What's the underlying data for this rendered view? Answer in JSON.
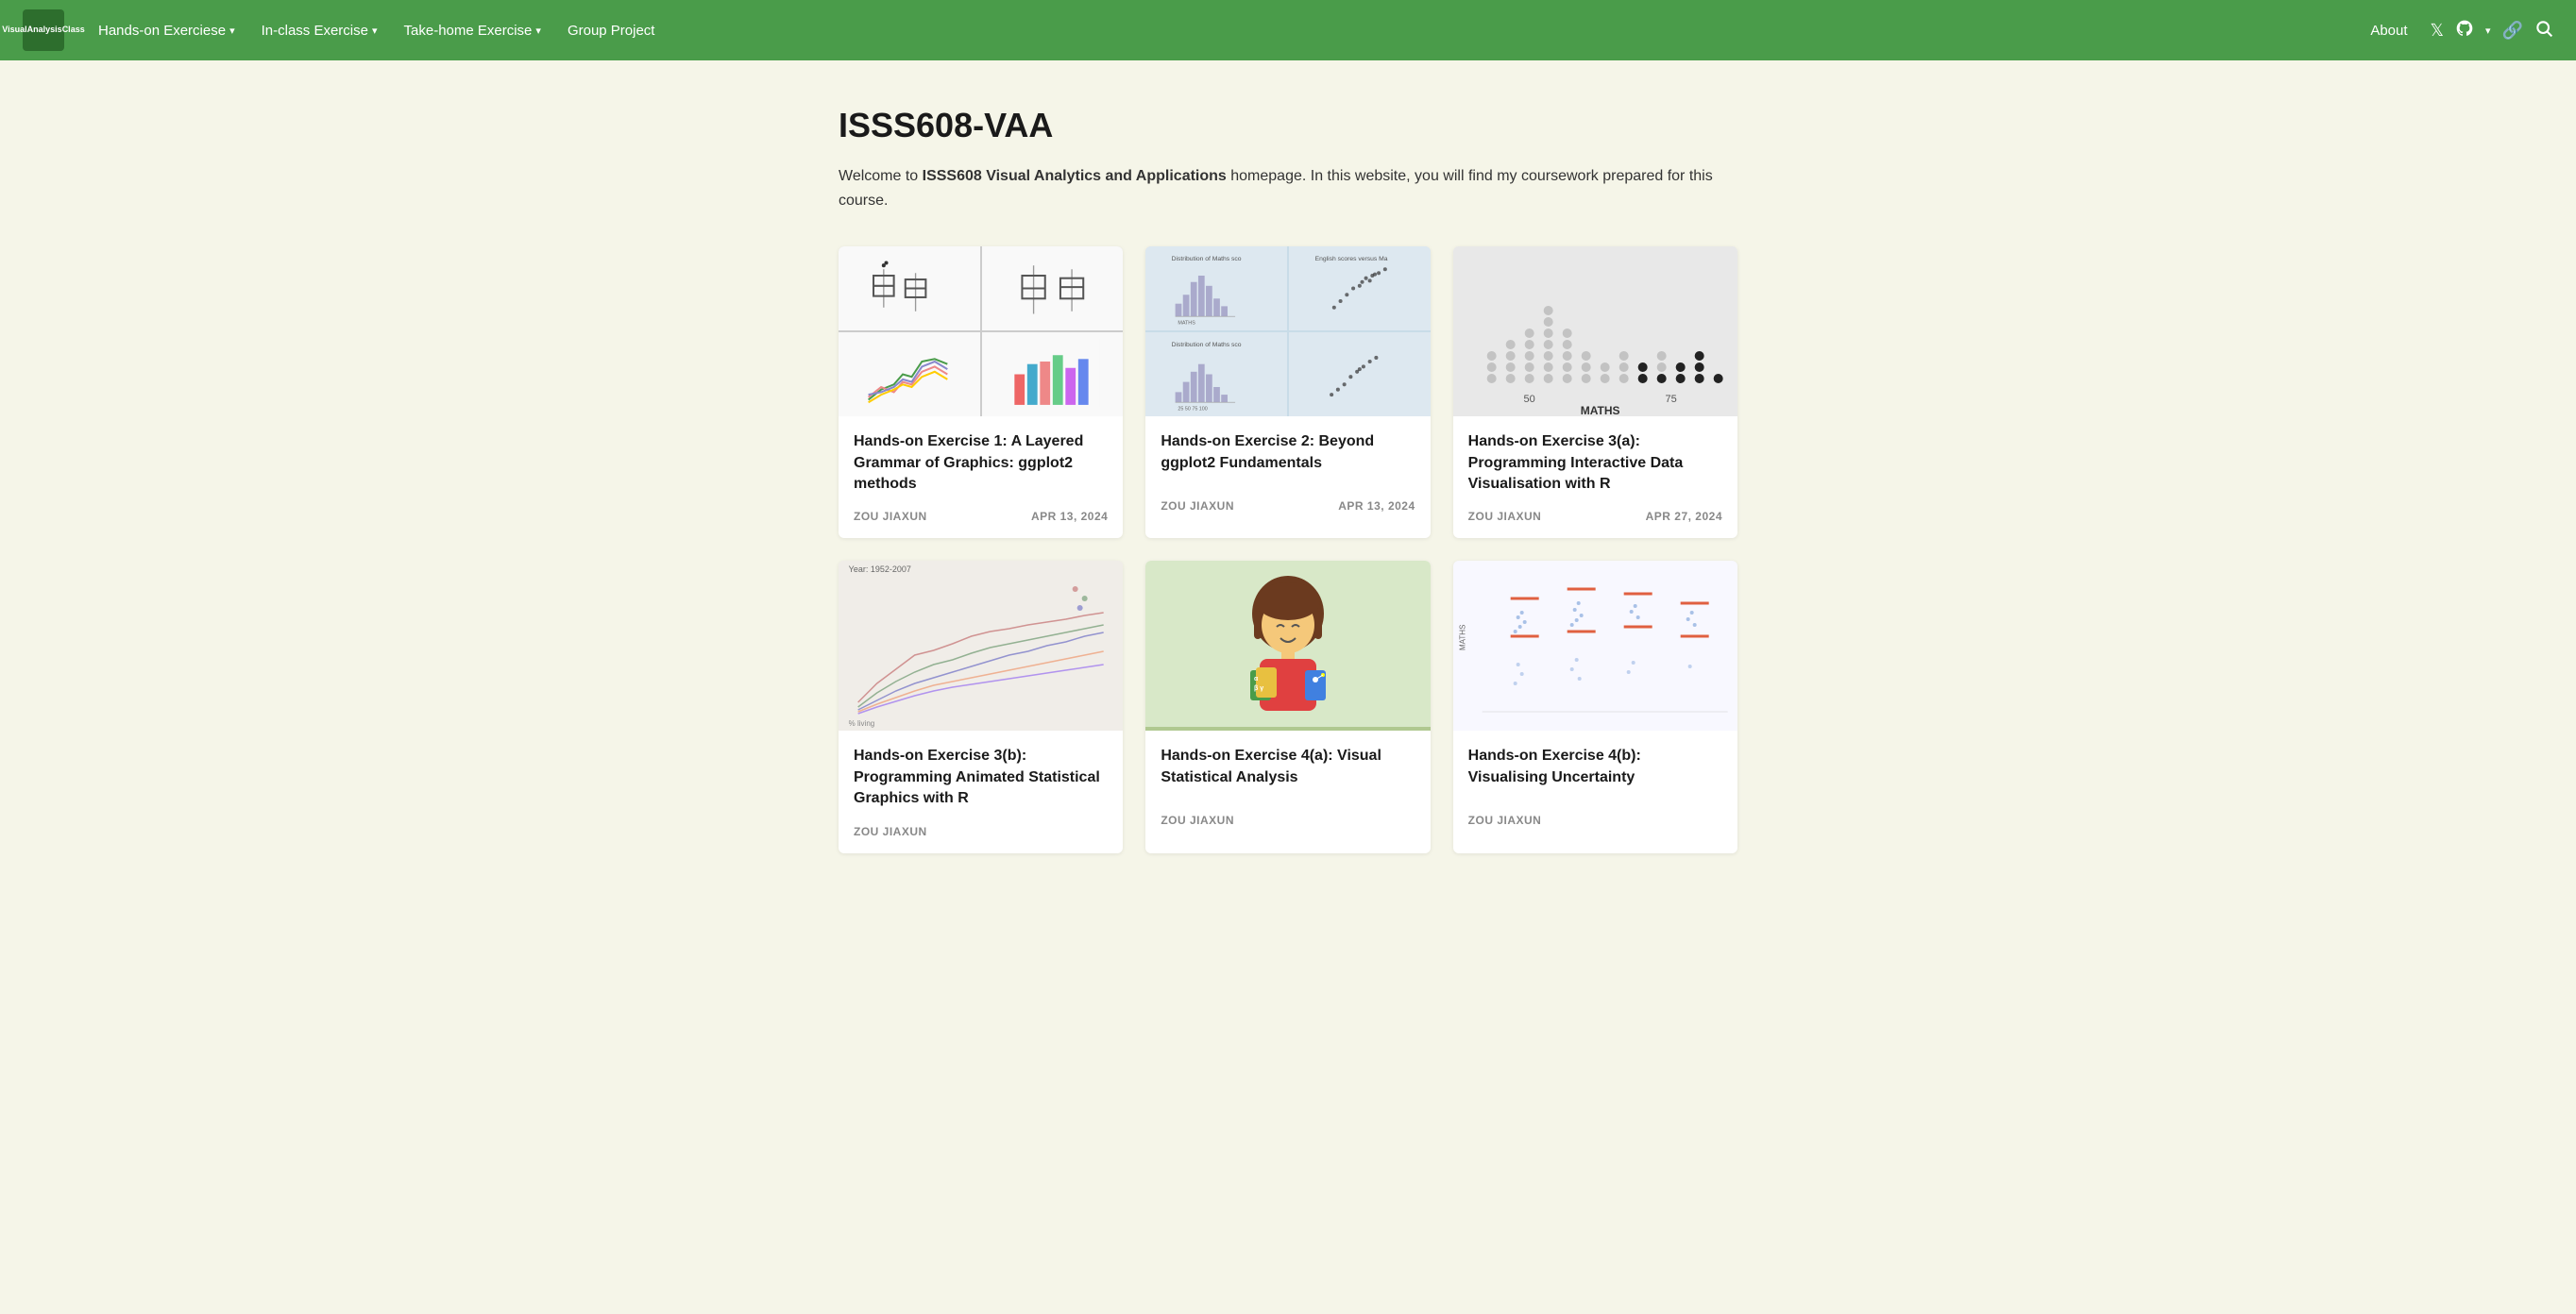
{
  "nav": {
    "logo_line1": "Visual",
    "logo_line2": "Analysis",
    "logo_line3": "Class",
    "items": [
      {
        "label": "Hands-on Exerciese",
        "has_dropdown": true
      },
      {
        "label": "In-class Exercise",
        "has_dropdown": true
      },
      {
        "label": "Take-home Exercise",
        "has_dropdown": true
      },
      {
        "label": "Group Project",
        "has_dropdown": false
      }
    ],
    "about_label": "About"
  },
  "main": {
    "title": "ISSS608-VAA",
    "intro_prefix": "Welcome to ",
    "intro_bold": "ISSS608 Visual Analytics and Applications",
    "intro_suffix": " homepage. In this website, you will find my coursework prepared for this course.",
    "cards": [
      {
        "title": "Hands-on Exercise 1: A Layered Grammar of Graphics: ggplot2 methods",
        "author": "ZOU JIAXUN",
        "date": "APR 13, 2024",
        "thumb_type": "4panel"
      },
      {
        "title": "Hands-on Exercise 2: Beyond ggplot2 Fundamentals",
        "author": "ZOU JIAXUN",
        "date": "APR 13, 2024",
        "thumb_type": "split2"
      },
      {
        "title": "Hands-on Exercise 3(a): Programming Interactive Data Visualisation with R",
        "author": "ZOU JIAXUN",
        "date": "APR 27, 2024",
        "thumb_type": "dotplot"
      },
      {
        "title": "Hands-on Exercise 3(b): Programming Animated Statistical Graphics with R",
        "author": "ZOU JIAXUN",
        "date": "",
        "thumb_type": "linechart"
      },
      {
        "title": "Hands-on Exercise 4(a): Visual Statistical Analysis",
        "author": "ZOU JIAXUN",
        "date": "",
        "thumb_type": "illustration"
      },
      {
        "title": "Hands-on Exercise 4(b): Visualising Uncertainty",
        "author": "ZOU JIAXUN",
        "date": "",
        "thumb_type": "scatter2"
      }
    ]
  }
}
